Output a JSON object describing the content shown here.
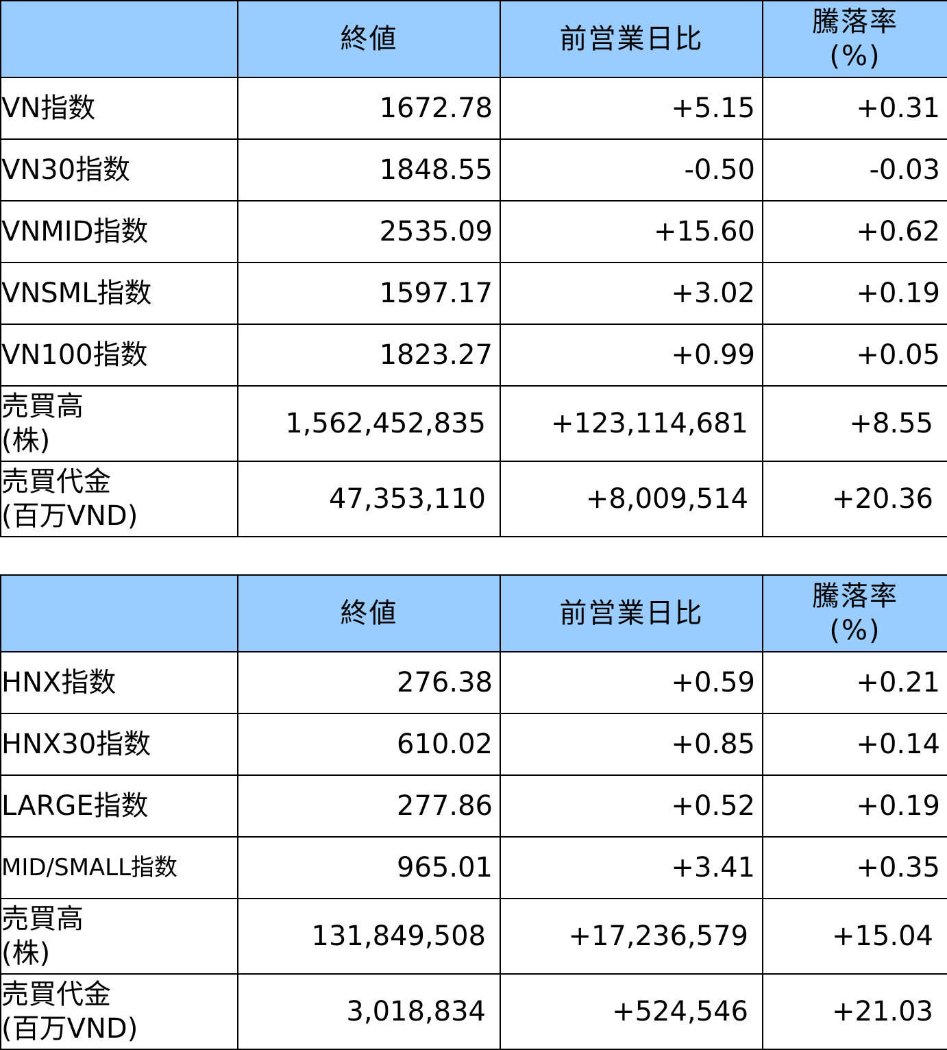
{
  "header": {
    "blank": "",
    "close": "終値",
    "change": "前営業日比",
    "pct_line1": "騰落率",
    "pct_line2": "(%)"
  },
  "hose": {
    "rows": [
      {
        "label": "VN指数",
        "close": "1672.78",
        "change": "+5.15",
        "pct": "+0.31"
      },
      {
        "label": "VN30指数",
        "close": "1848.55",
        "change": "-0.50",
        "pct": "-0.03"
      },
      {
        "label": "VNMID指数",
        "close": "2535.09",
        "change": "+15.60",
        "pct": "+0.62"
      },
      {
        "label": "VNSML指数",
        "close": "1597.17",
        "change": "+3.02",
        "pct": "+0.19"
      },
      {
        "label": "VN100指数",
        "close": "1823.27",
        "change": "+0.99",
        "pct": "+0.05"
      }
    ],
    "volume": {
      "label1": "売買高",
      "label2": "(株)",
      "close": "1,562,452,835",
      "change": "+123,114,681",
      "pct": "+8.55"
    },
    "value": {
      "label1": "売買代金",
      "label2": "(百万VND)",
      "close": "47,353,110",
      "change": "+8,009,514",
      "pct": "+20.36"
    }
  },
  "hnx": {
    "rows": [
      {
        "label": "HNX指数",
        "close": "276.38",
        "change": "+0.59",
        "pct": "+0.21"
      },
      {
        "label": "HNX30指数",
        "close": "610.02",
        "change": "+0.85",
        "pct": "+0.14"
      },
      {
        "label": "LARGE指数",
        "close": "277.86",
        "change": "+0.52",
        "pct": "+0.19"
      },
      {
        "label": "MID/SMALL指数",
        "close": "965.01",
        "change": "+3.41",
        "pct": "+0.35"
      }
    ],
    "volume": {
      "label1": "売買高",
      "label2": "(株)",
      "close": "131,849,508",
      "change": "+17,236,579",
      "pct": "+15.04"
    },
    "value": {
      "label1": "売買代金",
      "label2": "(百万VND)",
      "close": "3,018,834",
      "change": "+524,546",
      "pct": "+21.03"
    }
  },
  "colors": {
    "header_bg": "#99ccff",
    "border": "#000000"
  }
}
